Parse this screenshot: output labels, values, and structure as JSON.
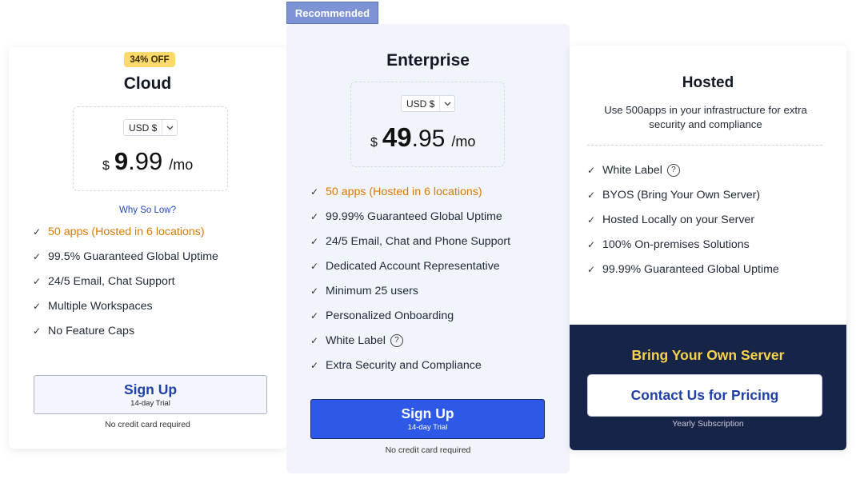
{
  "recommended_label": "Recommended",
  "cloud": {
    "discount": "34% OFF",
    "title": "Cloud",
    "currency": "USD $",
    "price_symbol": "$",
    "price_int": "9",
    "price_cents": ".99",
    "price_per": "/mo",
    "why_low": "Why So Low?",
    "features": [
      {
        "label": "50 apps (Hosted in 6 locations)",
        "highlight": true
      },
      {
        "label": "99.5% Guaranteed Global Uptime"
      },
      {
        "label": "24/5 Email, Chat Support"
      },
      {
        "label": "Multiple Workspaces"
      },
      {
        "label": "No Feature Caps"
      }
    ],
    "cta_main": "Sign Up",
    "cta_sub": "14-day Trial",
    "note": "No credit card required"
  },
  "enterprise": {
    "title": "Enterprise",
    "currency": "USD $",
    "price_symbol": "$",
    "price_int": "49",
    "price_cents": ".95",
    "price_per": "/mo",
    "features": [
      {
        "label": "50 apps (Hosted in 6 locations)",
        "highlight": true
      },
      {
        "label": "99.99% Guaranteed Global Uptime"
      },
      {
        "label": "24/5 Email, Chat and Phone Support"
      },
      {
        "label": "Dedicated Account Representative"
      },
      {
        "label": "Minimum 25 users"
      },
      {
        "label": "Personalized Onboarding"
      },
      {
        "label": "White Label",
        "help": true
      },
      {
        "label": "Extra Security and Compliance"
      }
    ],
    "cta_main": "Sign Up",
    "cta_sub": "14-day Trial",
    "note": "No credit card required"
  },
  "hosted": {
    "title": "Hosted",
    "description": "Use 500apps in your infrastructure for extra security and compliance",
    "features": [
      {
        "label": "White Label",
        "help": true
      },
      {
        "label": "BYOS (Bring Your Own Server)"
      },
      {
        "label": "Hosted Locally on your Server"
      },
      {
        "label": "100% On-premises Solutions"
      },
      {
        "label": "99.99% Guaranteed Global Uptime"
      }
    ],
    "byos_title": "Bring Your Own Server",
    "cta": "Contact Us for Pricing",
    "note": "Yearly Subscription"
  },
  "icons": {
    "check": "check-icon",
    "chevron": "chevron-down-icon",
    "help": "question-circle-icon"
  },
  "colors": {
    "primary": "#2e59e8",
    "highlight": "#d97a06",
    "navy": "#162447",
    "gold": "#f9d34a",
    "badge": "#fcd96b"
  }
}
